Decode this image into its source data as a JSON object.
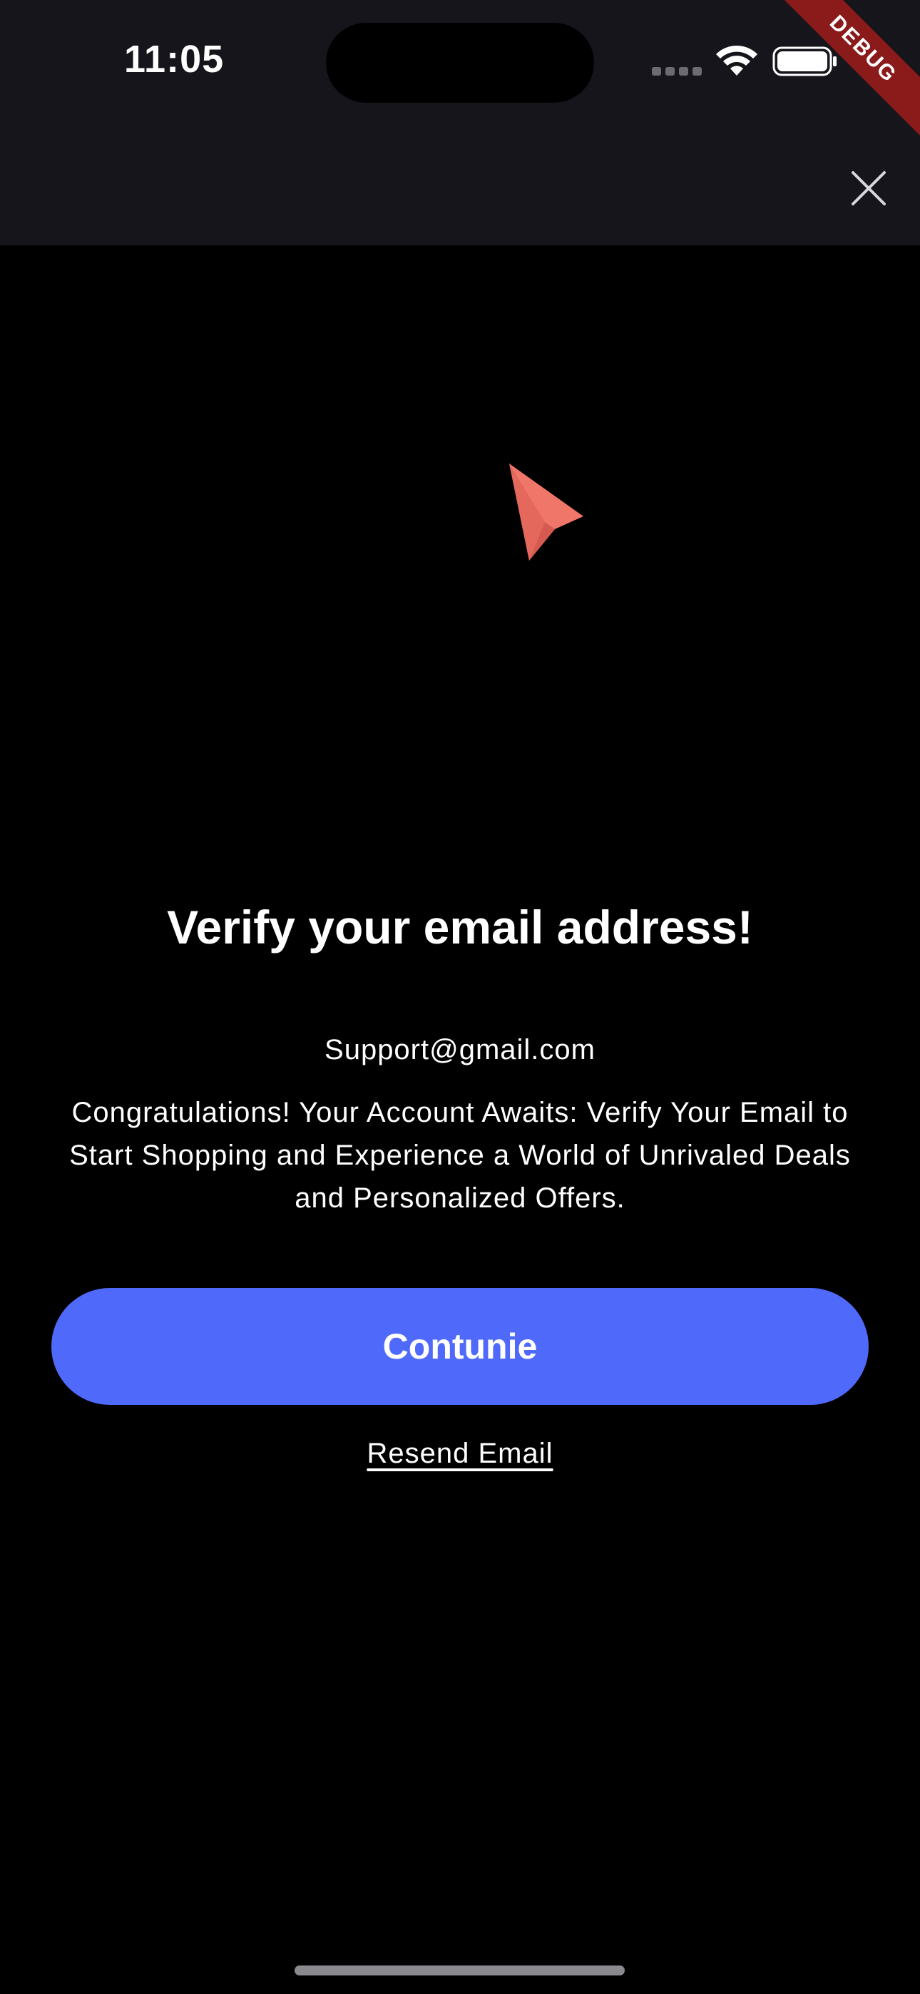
{
  "status_bar": {
    "time": "11:05"
  },
  "debug_banner": "DEBUG",
  "icons": {
    "close": "close-icon",
    "illustration": "paper-plane-icon",
    "wifi": "wifi-icon",
    "battery": "battery-icon"
  },
  "content": {
    "title": "Verify your email address!",
    "email": "Support@gmail.com",
    "description": "Congratulations! Your Account Awaits: Verify Your Email to Start Shopping and Experience a World of Unrivaled Deals and Personalized Offers.",
    "continue_label": "Contunie",
    "resend_label": "Resend Email"
  },
  "colors": {
    "background": "#000000",
    "top_bar": "#16151c",
    "primary_button": "#4f69fb",
    "illustration": "#f0766a",
    "debug_ribbon": "#8b1a1a"
  }
}
